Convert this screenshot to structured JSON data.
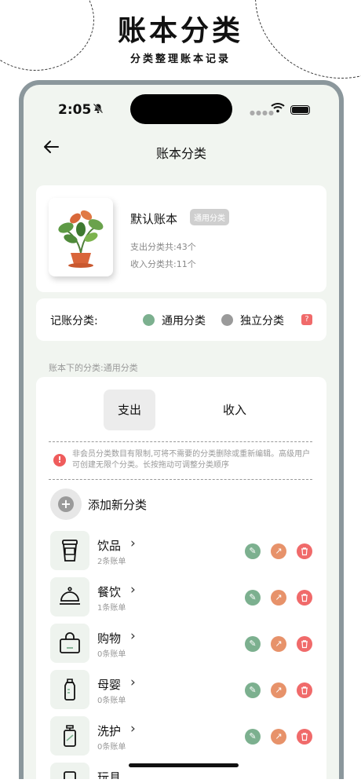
{
  "promo": {
    "title": "账本分类",
    "subtitle": "分类整理账本记录"
  },
  "status_bar": {
    "time": "2:05",
    "bell_icon": "bell-slash-icon"
  },
  "nav": {
    "title": "账本分类",
    "back_icon": "arrow-left-icon"
  },
  "book": {
    "name": "默认账本",
    "badge": "通用分类",
    "expense_stat": "支出分类共:43个",
    "income_stat": "收入分类共:11个",
    "cover_icon": "potted-plant-image"
  },
  "mode": {
    "label": "记账分类:",
    "option_common": "通用分类",
    "option_independent": "独立分类",
    "help": "?",
    "colors": {
      "common": "#7cb08f",
      "independent": "#9a9a9a"
    }
  },
  "section_hint": "账本下的分类:通用分类",
  "tabs": {
    "expense": "支出",
    "income": "收入",
    "active": "expense"
  },
  "notice": {
    "icon": "!",
    "text": "非会员分类数目有限制,可将不需要的分类删除或重新编辑。高级用户可创建无限个分类。长按拖动可调整分类顺序"
  },
  "add": {
    "icon": "+",
    "label": "添加新分类"
  },
  "categories": [
    {
      "name": "饮品",
      "count": "2条账单",
      "icon": "cup-icon"
    },
    {
      "name": "餐饮",
      "count": "1条账单",
      "icon": "cloche-icon"
    },
    {
      "name": "购物",
      "count": "0条账单",
      "icon": "shopping-bag-icon"
    },
    {
      "name": "母婴",
      "count": "0条账单",
      "icon": "baby-bottle-icon"
    },
    {
      "name": "洗护",
      "count": "0条账单",
      "icon": "pump-bottle-icon"
    },
    {
      "name": "玩具",
      "count": "",
      "icon": "toy-icon"
    }
  ],
  "actions": {
    "edit_icon": "pencil-icon",
    "move_icon": "arrow-up-right-icon",
    "delete_icon": "trash-icon",
    "colors": {
      "edit": "#7cb08f",
      "move": "#e7926a",
      "delete": "#f06a6a"
    }
  }
}
